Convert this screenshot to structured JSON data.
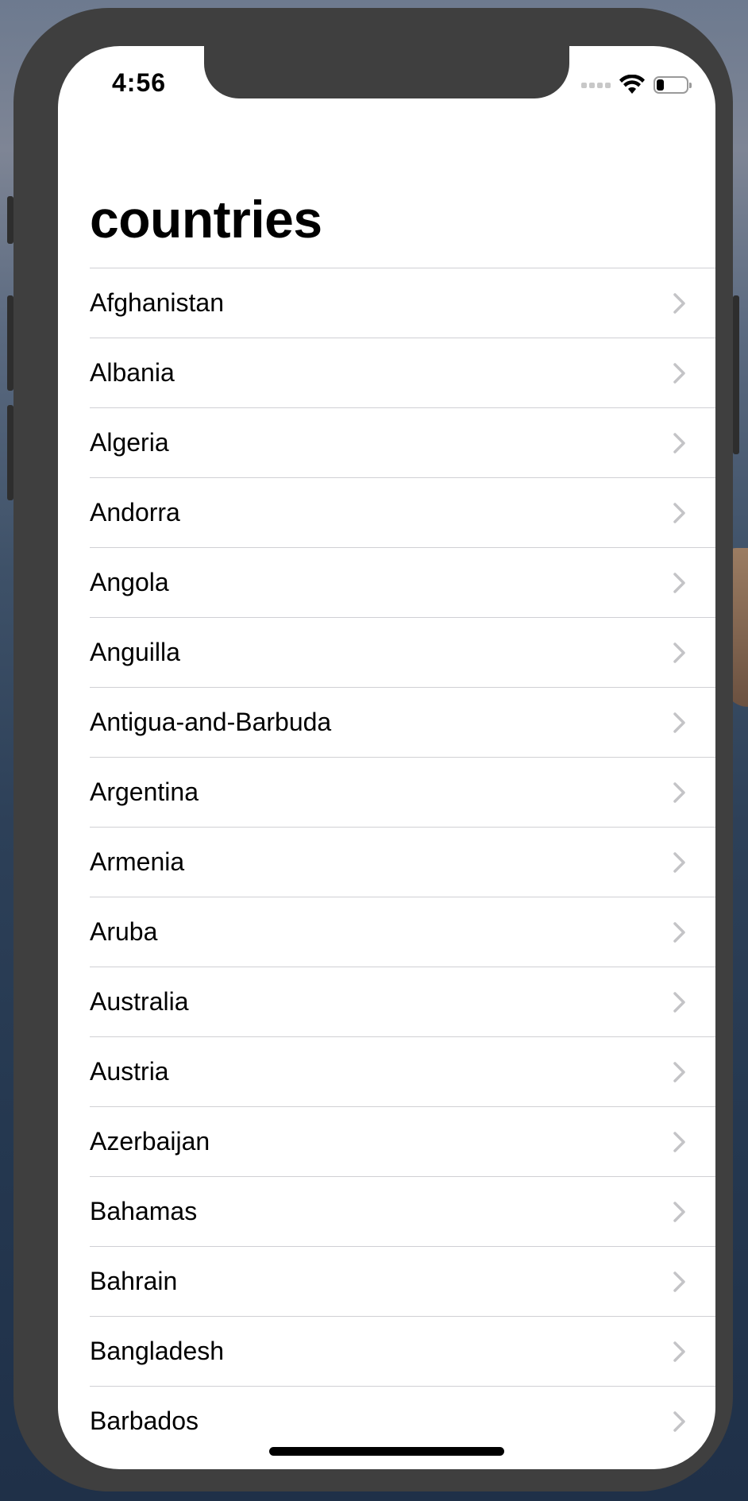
{
  "status_bar": {
    "time": "4:56",
    "battery_level": 0.25
  },
  "page": {
    "title": "countries"
  },
  "countries": [
    "Afghanistan",
    "Albania",
    "Algeria",
    "Andorra",
    "Angola",
    "Anguilla",
    "Antigua-and-Barbuda",
    "Argentina",
    "Armenia",
    "Aruba",
    "Australia",
    "Austria",
    "Azerbaijan",
    "Bahamas",
    "Bahrain",
    "Bangladesh",
    "Barbados"
  ],
  "icons": {
    "row_accessory": "chevron-right-icon",
    "wifi": "wifi-icon",
    "cellular": "cellular-signal-icon",
    "battery": "battery-icon"
  },
  "colors": {
    "chevron": "#c4c4c7",
    "separator": "#d0d0d4",
    "device_frame": "#3f3f3f"
  }
}
